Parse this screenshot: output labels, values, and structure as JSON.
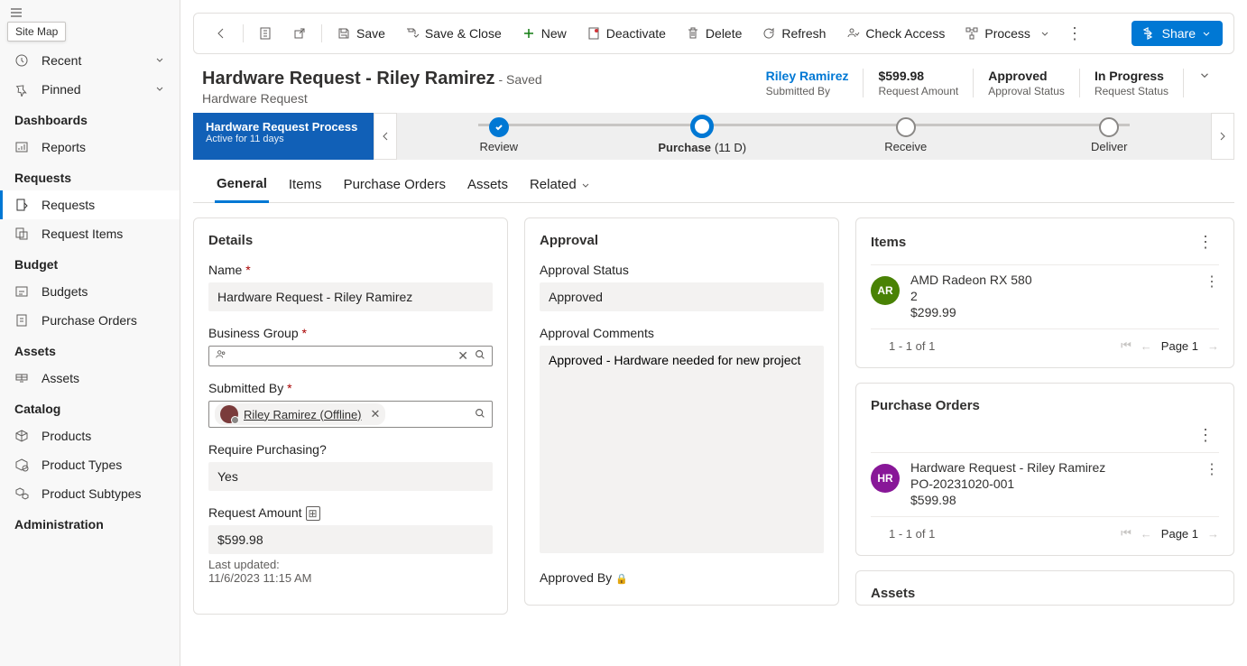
{
  "tooltip": "Site Map",
  "sidebar": {
    "recent": "Recent",
    "pinned": "Pinned",
    "sections": [
      {
        "header": "Dashboards",
        "items": [
          {
            "label": "Reports",
            "icon": "reports"
          }
        ]
      },
      {
        "header": "Requests",
        "items": [
          {
            "label": "Requests",
            "icon": "request",
            "active": true
          },
          {
            "label": "Request Items",
            "icon": "request-items"
          }
        ]
      },
      {
        "header": "Budget",
        "items": [
          {
            "label": "Budgets",
            "icon": "budget"
          },
          {
            "label": "Purchase Orders",
            "icon": "po"
          }
        ]
      },
      {
        "header": "Assets",
        "items": [
          {
            "label": "Assets",
            "icon": "assets"
          }
        ]
      },
      {
        "header": "Catalog",
        "items": [
          {
            "label": "Products",
            "icon": "product"
          },
          {
            "label": "Product Types",
            "icon": "product-type"
          },
          {
            "label": "Product Subtypes",
            "icon": "product-subtype"
          }
        ]
      },
      {
        "header": "Administration",
        "items": []
      }
    ]
  },
  "toolbar": {
    "save": "Save",
    "save_close": "Save & Close",
    "new": "New",
    "deactivate": "Deactivate",
    "delete": "Delete",
    "refresh": "Refresh",
    "check_access": "Check Access",
    "process": "Process",
    "share": "Share"
  },
  "header": {
    "title": "Hardware Request - Riley Ramirez",
    "saved": " - Saved",
    "subtitle": "Hardware Request",
    "fields": [
      {
        "value": "Riley Ramirez",
        "label": "Submitted By",
        "link": true
      },
      {
        "value": "$599.98",
        "label": "Request Amount"
      },
      {
        "value": "Approved",
        "label": "Approval Status"
      },
      {
        "value": "In Progress",
        "label": "Request Status"
      }
    ]
  },
  "process": {
    "name": "Hardware Request Process",
    "sub": "Active for 11 days",
    "stages": [
      {
        "label": "Review",
        "state": "done"
      },
      {
        "label": "Purchase",
        "sub": "(11 D)",
        "state": "active"
      },
      {
        "label": "Receive",
        "state": "future"
      },
      {
        "label": "Deliver",
        "state": "future"
      }
    ]
  },
  "tabs": [
    "General",
    "Items",
    "Purchase Orders",
    "Assets",
    "Related"
  ],
  "details": {
    "title": "Details",
    "name_label": "Name",
    "name": "Hardware Request - Riley Ramirez",
    "bg_label": "Business Group",
    "submitted_label": "Submitted By",
    "submitted": "Riley Ramirez (Offline)",
    "require_label": "Require Purchasing?",
    "require": "Yes",
    "amount_label": "Request Amount",
    "amount": "$599.98",
    "updated_label": "Last updated:",
    "updated": "11/6/2023 11:15 AM"
  },
  "approval": {
    "title": "Approval",
    "status_label": "Approval Status",
    "status": "Approved",
    "comments_label": "Approval Comments",
    "comments": "Approved - Hardware needed for new project",
    "by_label": "Approved By"
  },
  "items_panel": {
    "title": "Items",
    "row": {
      "initials": "AR",
      "color": "#498205",
      "name": "AMD Radeon RX 580",
      "qty": "2",
      "price": "$299.99"
    },
    "pager": "1 - 1 of 1",
    "page": "Page 1"
  },
  "po_panel": {
    "title": "Purchase Orders",
    "row": {
      "initials": "HR",
      "color": "#881798",
      "name": "Hardware Request - Riley Ramirez",
      "num": "PO-20231020-001",
      "amount": "$599.98"
    },
    "pager": "1 - 1 of 1",
    "page": "Page 1"
  },
  "assets_panel": {
    "title": "Assets"
  }
}
